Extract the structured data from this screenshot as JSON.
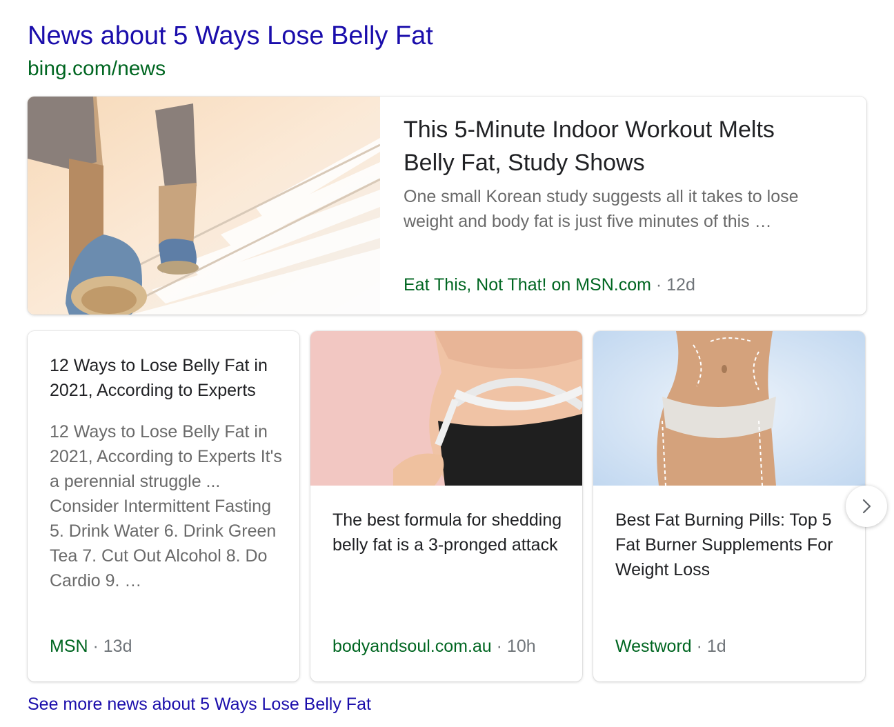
{
  "header": {
    "title": "News about 5 Ways Lose Belly Fat",
    "url": "bing.com/news"
  },
  "featured": {
    "title": "This 5-Minute Indoor Workout Melts Belly Fat, Study Shows",
    "snippet": "One small Korean study suggests all it takes to lose weight and body fat is just five minutes of this …",
    "source": "Eat This, Not That! on MSN.com",
    "age": " · 12d",
    "image": "stairs-walking-photo"
  },
  "cards": [
    {
      "title": "12 Ways to Lose Belly Fat in 2021, According to Experts",
      "snippet": "12 Ways to Lose Belly Fat in 2021, According to Experts It's a perennial struggle ... Consider Intermittent Fasting 5. Drink Water 6. Drink Green Tea 7. Cut Out Alcohol 8. Do Cardio 9. …",
      "source": "MSN",
      "age": " · 13d"
    },
    {
      "title": "The best formula for shedding belly fat is a 3-pronged attack",
      "source": "bodyandsoul.com.au",
      "age": " · 10h",
      "image": "measuring-tape-waist-photo"
    },
    {
      "title": "Best Fat Burning Pills: Top 5 Fat Burner Supplements For Weight Loss",
      "source": "Westword",
      "age": " · 1d",
      "image": "body-contour-photo"
    }
  ],
  "next_icon": "chevron-right-icon",
  "see_more": "See more news about 5 Ways Lose Belly Fat",
  "colors": {
    "link": "#1a0dab",
    "url_green": "#006621",
    "meta_grey": "#70757a",
    "snippet_grey": "#6a6a6a"
  }
}
